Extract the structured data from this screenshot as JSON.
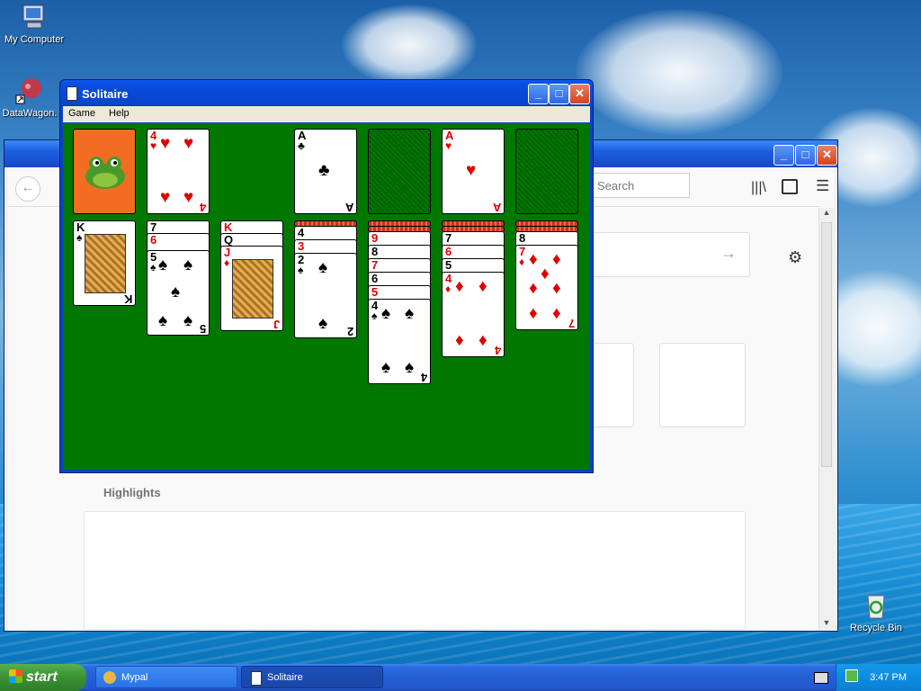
{
  "desktop": {
    "icons": [
      {
        "label": "My Computer"
      },
      {
        "label": "DataWagon."
      },
      {
        "label": "Recycle Bin"
      }
    ]
  },
  "browser": {
    "search_placeholder": "Search",
    "highlights_label": "Highlights"
  },
  "solitaire": {
    "title": "Solitaire",
    "menu": [
      "Game",
      "Help"
    ],
    "waste": {
      "rank": "4",
      "suit": "♥"
    },
    "foundations": [
      {
        "rank": "A",
        "suit": "♣"
      },
      {
        "rank": "A",
        "suit": "♥"
      }
    ],
    "tableau": [
      {
        "cards": [
          "K♠"
        ]
      },
      {
        "cards": [
          "7♠",
          "6♥",
          "5♠"
        ]
      },
      {
        "cards": [
          "K♥",
          "Q♠",
          "J♦"
        ]
      },
      {
        "cards": [
          "4♠",
          "3♥",
          "2♠"
        ]
      },
      {
        "cards": [
          "9♥",
          "8♠",
          "7♥",
          "6♠",
          "5♥",
          "4♠"
        ]
      },
      {
        "cards": [
          "7♠",
          "6♥",
          "5♠",
          "4♦"
        ]
      },
      {
        "cards": [
          "8♠",
          "7♦"
        ]
      }
    ]
  },
  "taskbar": {
    "start_label": "start",
    "tasks": [
      {
        "label": "Mypal"
      },
      {
        "label": "Solitaire"
      }
    ],
    "clock": "3:47 PM"
  }
}
